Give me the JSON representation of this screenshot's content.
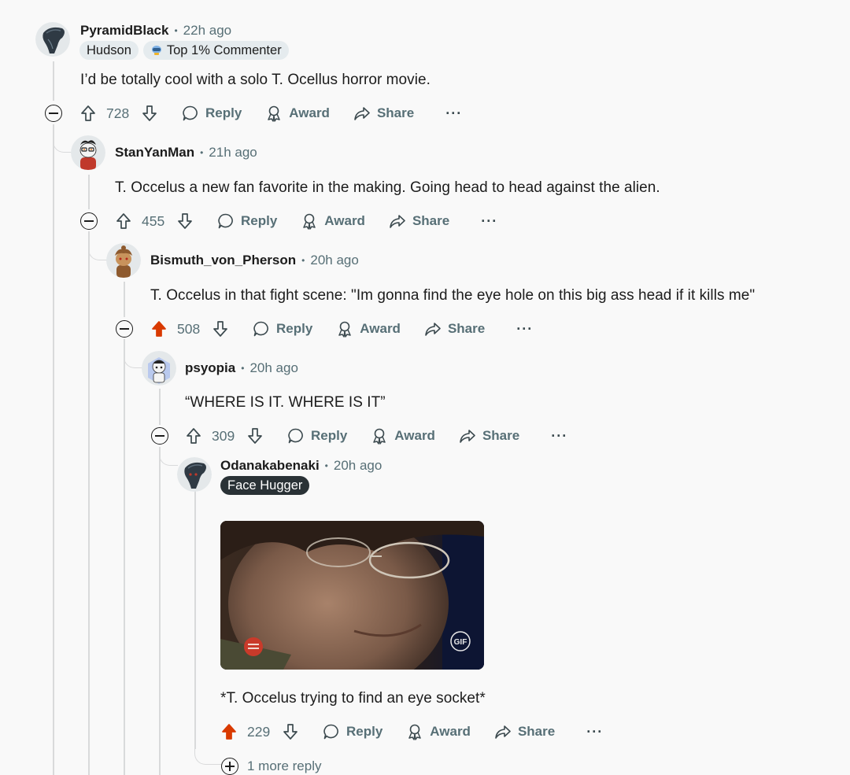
{
  "colors": {
    "upvoted": "#d93a00",
    "text_secondary": "#576f76",
    "thread_line": "#d9dadb"
  },
  "comments": [
    {
      "username": "PyramidBlack",
      "time": "22h ago",
      "flairs": [
        "Hudson",
        "Top 1% Commenter"
      ],
      "body": "I’d be totally cool with a solo T. Ocellus horror movie.",
      "score": "728",
      "upvoted": false,
      "actions": {
        "reply": "Reply",
        "award": "Award",
        "share": "Share",
        "more": "···"
      }
    },
    {
      "username": "StanYanMan",
      "time": "21h ago",
      "body": "T. Occelus a new fan favorite in the making. Going head to head against the alien.",
      "score": "455",
      "upvoted": false,
      "actions": {
        "reply": "Reply",
        "award": "Award",
        "share": "Share",
        "more": "···"
      }
    },
    {
      "username": "Bismuth_von_Pherson",
      "time": "20h ago",
      "body": "T. Occelus in that fight scene: \"Im gonna find the eye hole on this big ass head if it kills me\"",
      "score": "508",
      "upvoted": true,
      "actions": {
        "reply": "Reply",
        "award": "Award",
        "share": "Share",
        "more": "···"
      }
    },
    {
      "username": "psyopia",
      "time": "20h ago",
      "body": "“WHERE IS IT. WHERE IS IT”",
      "score": "309",
      "upvoted": false,
      "actions": {
        "reply": "Reply",
        "award": "Award",
        "share": "Share",
        "more": "···"
      }
    },
    {
      "username": "Odanakabenaki",
      "time": "20h ago",
      "flairs": [
        "Face Hugger"
      ],
      "gif_badge": "GIF",
      "body": "*T. Occelus trying to find an eye socket*",
      "score": "229",
      "upvoted": true,
      "actions": {
        "reply": "Reply",
        "award": "Award",
        "share": "Share",
        "more": "···"
      },
      "more_replies": "1 more reply"
    }
  ]
}
